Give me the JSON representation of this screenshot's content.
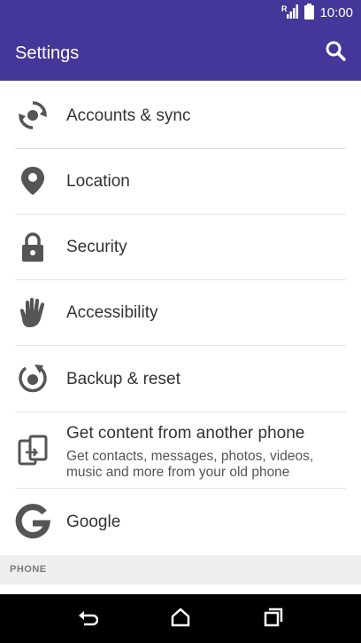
{
  "status_bar": {
    "time": "10:00",
    "icons": [
      "signal-icon",
      "battery-icon"
    ]
  },
  "header": {
    "title": "Settings",
    "search_icon": "search-icon"
  },
  "items": [
    {
      "label": "Accounts & sync",
      "icon": "sync-icon"
    },
    {
      "label": "Location",
      "icon": "location-pin-icon"
    },
    {
      "label": "Security",
      "icon": "lock-icon"
    },
    {
      "label": "Accessibility",
      "icon": "hand-icon"
    },
    {
      "label": "Backup & reset",
      "icon": "backup-reset-icon"
    },
    {
      "label": "Get content from another phone",
      "sub1": "Get contacts, messages, photos, videos,",
      "sub2": "music and more from your old phone",
      "icon": "transfer-phone-icon"
    },
    {
      "label": "Google",
      "icon": "google-icon"
    }
  ],
  "section": {
    "label": "PHONE"
  },
  "nav_bar": {
    "icons": [
      "back-icon",
      "home-icon",
      "recents-icon"
    ]
  },
  "colors": {
    "primary": "#43389a",
    "icon": "#555555",
    "navbar": "#000000"
  }
}
